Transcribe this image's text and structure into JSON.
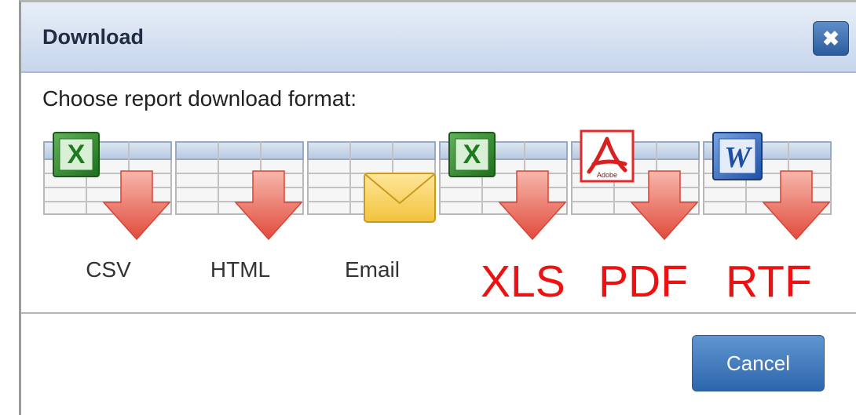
{
  "dialog": {
    "title": "Download",
    "close_label": "✖",
    "prompt": "Choose report download format:",
    "cancel_label": "Cancel"
  },
  "formats": [
    {
      "id": "csv",
      "label": "CSV",
      "icon": "excel-download-icon"
    },
    {
      "id": "html",
      "label": "HTML",
      "icon": "table-download-icon"
    },
    {
      "id": "email",
      "label": "Email",
      "icon": "envelope-icon"
    },
    {
      "id": "xls",
      "label": "",
      "icon": "excel-download-icon"
    },
    {
      "id": "pdf",
      "label": "",
      "icon": "pdf-download-icon"
    },
    {
      "id": "rtf",
      "label": "",
      "icon": "word-download-icon"
    }
  ],
  "annotations": {
    "xls": "XLS",
    "pdf": "PDF",
    "rtf": "RTF",
    "color": "#ee1111"
  },
  "badges": {
    "excel": "X",
    "pdf_small": "Adobe",
    "word": "W"
  },
  "colors": {
    "titlebar": "#c7d6ec",
    "button": "#2e66ad",
    "arrow": "#e55a4a"
  }
}
